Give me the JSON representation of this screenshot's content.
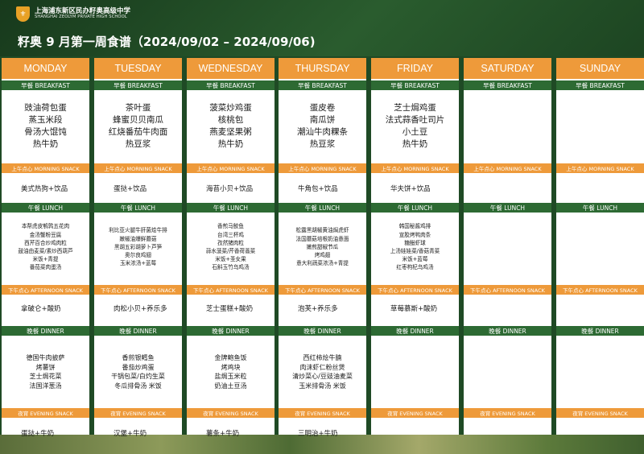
{
  "school": {
    "name_cn": "上海浦东新区民办籽奥高级中学",
    "name_en": "SHANGHAI ZEOLYM PRIVATE HIGH SCHOOL"
  },
  "title": "籽奥 9 月第一周食谱（2024/09/02 – 2024/09/06)",
  "meal_labels": {
    "breakfast": "早餐 BREAKFAST",
    "morning_snack": "上午点心 MORNING SNACK",
    "lunch": "午餐 LUNCH",
    "afternoon_snack": "下午点心 AFTERNOON SNACK",
    "dinner": "晚餐 DINNER",
    "evening_snack": "夜宵 EVENING SNACK"
  },
  "days": [
    {
      "name": "MONDAY",
      "breakfast": [
        "豉油荷包蛋",
        "蒸玉米段",
        "骨汤大馄饨",
        "热牛奶"
      ],
      "morning_snack": "美式热狗+饮品",
      "lunch": [
        "本帮虎皮鹌鹑五花肉",
        "金汤蟹粉豆腐",
        "西芹百合炒鸡肉粒",
        "鼓油由麦菜/素炒西葫芦",
        "米饭+青提",
        "番茄菜肉蛋汤"
      ],
      "afternoon_snack": "拿破仑+酸奶",
      "dinner": [
        "德国牛肉披萨",
        "烤薯饼",
        "芝士焗花菜",
        "法国洋葱汤"
      ],
      "evening_snack": "蛋挞+牛奶"
    },
    {
      "name": "TUESDAY",
      "breakfast": [
        "茶叶蛋",
        "蜂蜜贝贝南瓜",
        "红烧番茄牛肉面",
        "热豆浆"
      ],
      "morning_snack": "蛋挞+饮品",
      "lunch": [
        "利比亚火腿牛肝菌烩牛排",
        "嫩椒油爆鲜蘑菇",
        "黑胡五彩胡萝卜芦笋",
        "奥尔良鸡翅",
        "玉米浓汤+蓝莓"
      ],
      "afternoon_snack": "肉松小贝+养乐多",
      "dinner": [
        "香煎银鳕鱼",
        "番茄炒鸡蛋",
        "干锅包菜/白灼生菜",
        "冬瓜排骨汤 米饭"
      ],
      "evening_snack": "汉堡+牛奶"
    },
    {
      "name": "WEDNESDAY",
      "breakfast": [
        "菠菜炒鸡蛋",
        "核桃包",
        "燕麦坚果粥",
        "热牛奶"
      ],
      "morning_snack": "海苔小贝+饮品",
      "lunch": [
        "香煎马鲛鱼",
        "台湾三杯鸡",
        "孜然猪肉粒",
        "蒜水菠菜/芹香荷蒿菜",
        "米饭+圣女果",
        "石斛玉竹乌鸡汤"
      ],
      "afternoon_snack": "芝士蛋糕+酸奶",
      "dinner": [
        "金牌鲍鱼饭",
        "烤鸡块",
        "盐焗玉米粒",
        "奶油土豆汤"
      ],
      "evening_snack": "薯条+牛奶"
    },
    {
      "name": "THURSDAY",
      "breakfast": [
        "蛋皮卷",
        "南瓜饼",
        "潮汕牛肉粿条",
        "热豆浆"
      ],
      "morning_snack": "牛角包+饮品",
      "lunch": [
        "松露黑胡椒黄油焗虎虾",
        "法国蘑菇培根奶油意面",
        "嫩煎甜椒节瓜",
        "烤鸡翅",
        "意大利蔬菜浓汤+青提"
      ],
      "afternoon_snack": "泡芙+养乐多",
      "dinner": [
        "西红柿烩牛腩",
        "肉沫虾仁粉丝煲",
        "清炒菜心/豆豉油麦菜",
        "玉米排骨汤 米饭"
      ],
      "evening_snack": "三明治+牛奶"
    },
    {
      "name": "FRIDAY",
      "breakfast": [
        "芝士焗鸡蛋",
        "法式蒜香吐司片",
        "小土豆",
        "热牛奶"
      ],
      "morning_snack": "华夫饼+饮品",
      "lunch": [
        "韩国秘酱鸡排",
        "宣胶烤鸭肉条",
        "糖醋虾球",
        "上汤娃娃菜/香菇青菜",
        "米饭+蓝莓",
        "红枣枸杞乌鸡汤"
      ],
      "afternoon_snack": "草莓慕斯+酸奶",
      "dinner": [],
      "evening_snack": ""
    },
    {
      "name": "SATURDAY",
      "breakfast": [],
      "morning_snack": "",
      "lunch": [],
      "afternoon_snack": "",
      "dinner": [],
      "evening_snack": ""
    },
    {
      "name": "SUNDAY",
      "breakfast": [],
      "morning_snack": "",
      "lunch": [],
      "afternoon_snack": "",
      "dinner": [],
      "evening_snack": ""
    }
  ],
  "colors": {
    "dark_green": "#1f4a25",
    "band_green": "#2d6a33",
    "orange": "#ee9a3a"
  }
}
